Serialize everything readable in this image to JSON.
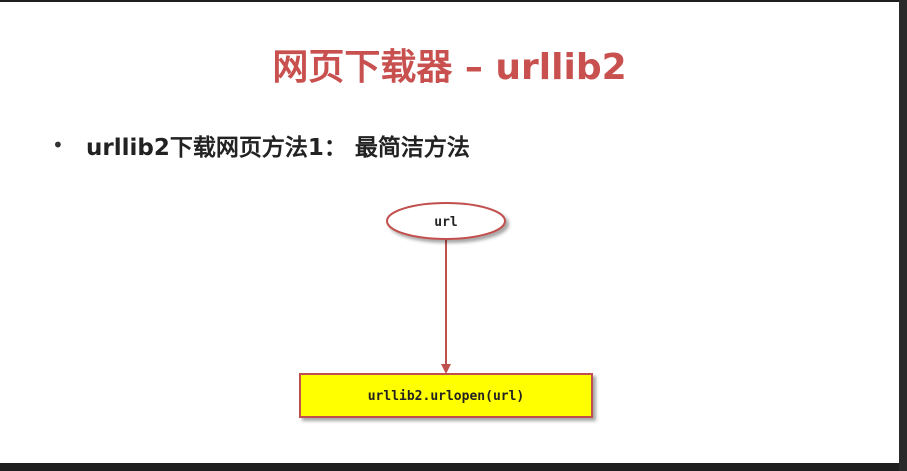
{
  "slide": {
    "title": "网页下载器 – urllib2",
    "bullet": "urllib2下载网页方法1： 最简洁方法",
    "bullet_symbol": "•"
  },
  "diagram": {
    "start_node_label": "url",
    "end_node_label": "urllib2.urlopen(url)",
    "colors": {
      "title": "#c8504f",
      "node_border": "#c0504d",
      "box_fill": "#ffff00",
      "arrow": "#c0504d"
    }
  }
}
